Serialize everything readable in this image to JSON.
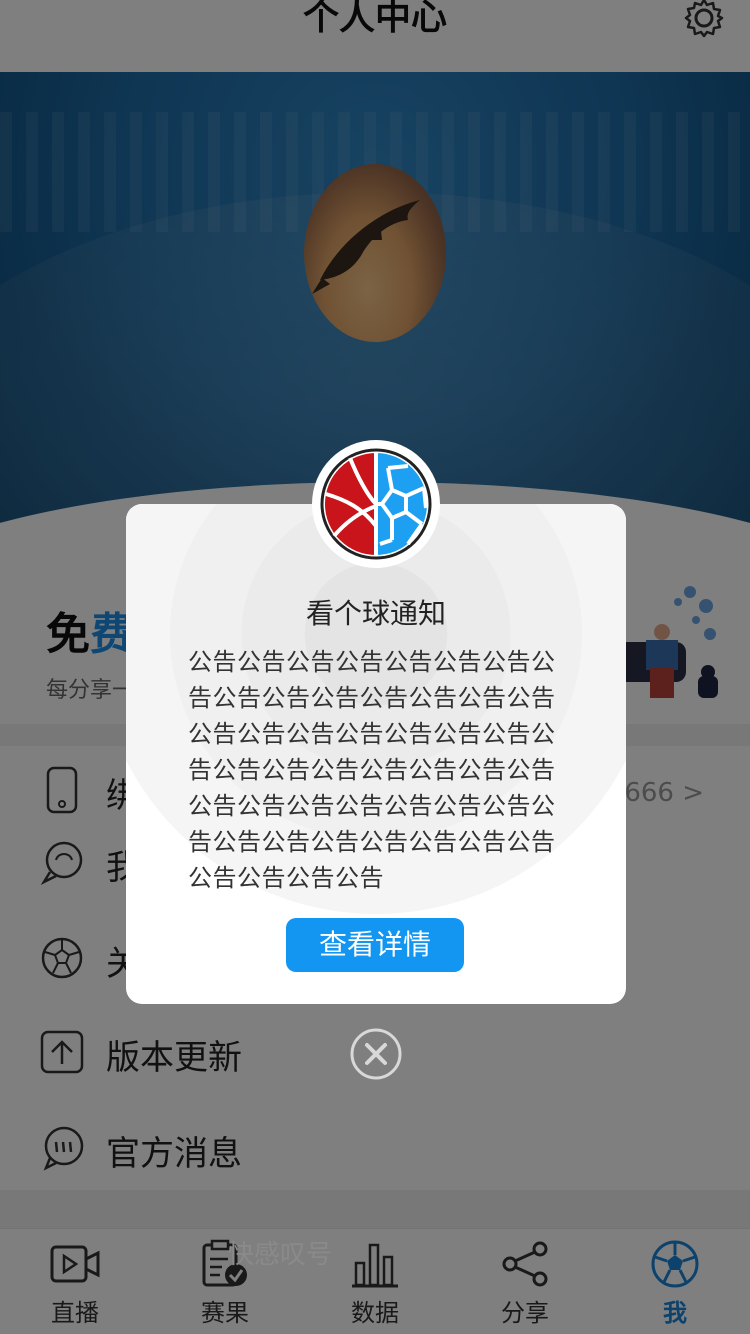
{
  "header": {
    "title": "个人中心",
    "settings_icon": "gear-icon"
  },
  "banner": {
    "avatar_icon": "dolphin-avatar"
  },
  "promo": {
    "title_prefix": "免",
    "title_accent": "费",
    "subtitle": "每分享一"
  },
  "menu": {
    "items": [
      {
        "label": "绑",
        "value": "6666 >",
        "icon": "phone-icon"
      },
      {
        "label": "我",
        "value": "",
        "icon": "chat-bubble-icon"
      },
      {
        "label": "关",
        "value": "",
        "icon": "soccer-ball-icon"
      },
      {
        "label": "版本更新",
        "value": "",
        "icon": "upload-arrow-icon"
      },
      {
        "label": "官方消息",
        "value": "",
        "icon": "message-icon"
      }
    ]
  },
  "dialog": {
    "title": "看个球通知",
    "body": "公告公告公告公告公告公告公告公告公告公告公告公告公告公告公告公告公告公告公告公告公告公告公告公告公告公告公告公告公告公告公告公告公告公告公告公告公告公告公告公告公告公告公告公告公告公告公告公告公告",
    "button": "查看详情",
    "logo_icon": "basketball-soccer-logo",
    "close_icon": "close-icon"
  },
  "nav": {
    "tabs": [
      {
        "label": "直播",
        "icon": "video-icon"
      },
      {
        "label": "赛果",
        "icon": "clipboard-check-icon"
      },
      {
        "label": "数据",
        "icon": "bar-chart-icon"
      },
      {
        "label": "分享",
        "icon": "share-icon"
      },
      {
        "label": "我",
        "icon": "soccer-ball-icon",
        "active": true
      }
    ],
    "ghost_text": "快感叹号"
  },
  "colors": {
    "accent": "#1296f2",
    "active_tab": "#1a85d8",
    "overlay": "rgba(0,0,0,0.5)"
  }
}
